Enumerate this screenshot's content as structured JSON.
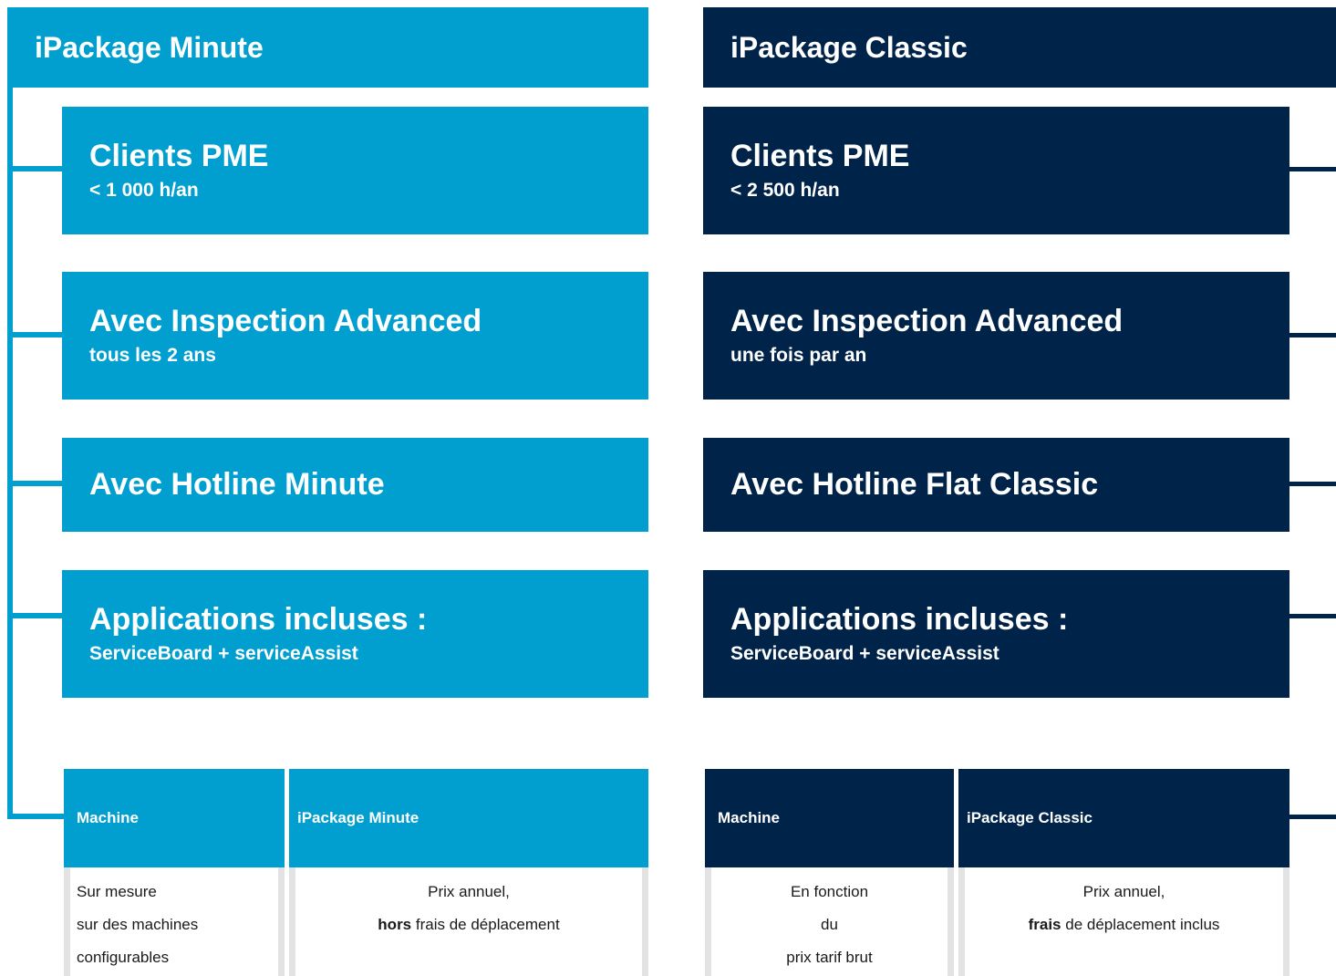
{
  "minute": {
    "header": "iPackage Minute",
    "cards": [
      {
        "title": "Clients PME",
        "subtitle": "< 1 000 h/an"
      },
      {
        "title": "Avec Inspection Advanced",
        "subtitle": "tous les 2 ans"
      },
      {
        "title": "Avec Hotline Minute",
        "subtitle": ""
      },
      {
        "title": "Applications incluses :",
        "subtitle": "ServiceBoard + serviceAssist"
      }
    ],
    "table": {
      "headers": [
        "Machine",
        "iPackage Minute"
      ],
      "machine_lines": [
        "Sur mesure",
        "sur des machines",
        "configurables"
      ],
      "price_line1": "Prix annuel,",
      "price_bold": "hors",
      "price_rest": " frais de déplacement"
    }
  },
  "classic": {
    "header": "iPackage Classic",
    "cards": [
      {
        "title": "Clients PME",
        "subtitle": "< 2 500 h/an"
      },
      {
        "title": "Avec Inspection Advanced",
        "subtitle": "une fois par an"
      },
      {
        "title": "Avec Hotline Flat Classic",
        "subtitle": ""
      },
      {
        "title": "Applications incluses :",
        "subtitle": "ServiceBoard + serviceAssist"
      }
    ],
    "table": {
      "headers": [
        "Machine",
        "iPackage Classic"
      ],
      "machine_lines": [
        "En fonction",
        "du",
        "prix tarif brut"
      ],
      "price_line1": "Prix annuel,",
      "price_bold": "frais",
      "price_rest": " de déplacement inclus"
    }
  },
  "colors": {
    "light_blue": "#009fd0",
    "dark_navy": "#00234a",
    "cell_border": "#e3e3e3"
  }
}
